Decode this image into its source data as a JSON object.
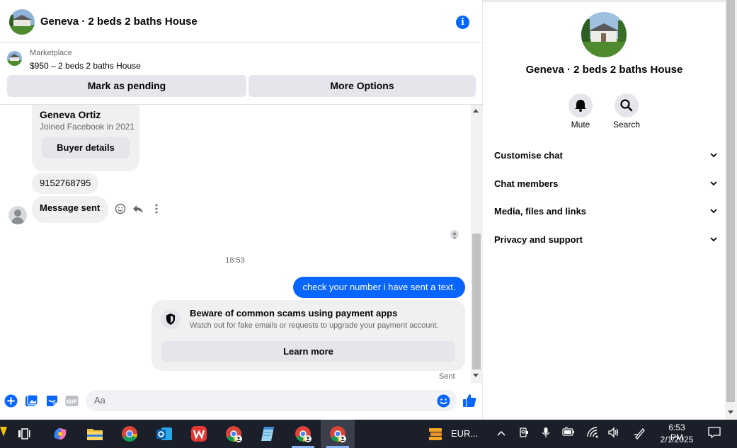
{
  "header": {
    "title": "Geneva · 2 beds 2 baths House",
    "info_icon": "i"
  },
  "marketplace": {
    "label": "Marketplace",
    "listing": "$950 – 2 beds 2 baths House",
    "mark_pending": "Mark as pending",
    "more_options": "More Options"
  },
  "messages": {
    "buyer_name": "Geneva Ortiz",
    "buyer_joined": "Joined Facebook in 2021",
    "buyer_details": "Buyer details",
    "phone": "9152768795",
    "message_sent": "Message sent",
    "time": "18:53",
    "outgoing": "check your number i have sent a text.",
    "warning_title": "Beware of common scams using payment apps",
    "warning_body": "Watch out for fake emails or requests to upgrade your payment account.",
    "learn_more": "Learn more",
    "status": "Sent"
  },
  "composer": {
    "placeholder": "Aa"
  },
  "info_panel": {
    "title": "Geneva · 2 beds 2 baths House",
    "mute": "Mute",
    "search": "Search",
    "sections": [
      "Customise chat",
      "Chat members",
      "Media, files and links",
      "Privacy and support"
    ]
  },
  "taskbar": {
    "weather": "EUR...",
    "time": "6:53 PM",
    "date": "2/1/2025"
  },
  "colors": {
    "accent": "#0866ff",
    "bubble_in": "#f0f0f0",
    "taskbar": "#1b1f2a"
  }
}
